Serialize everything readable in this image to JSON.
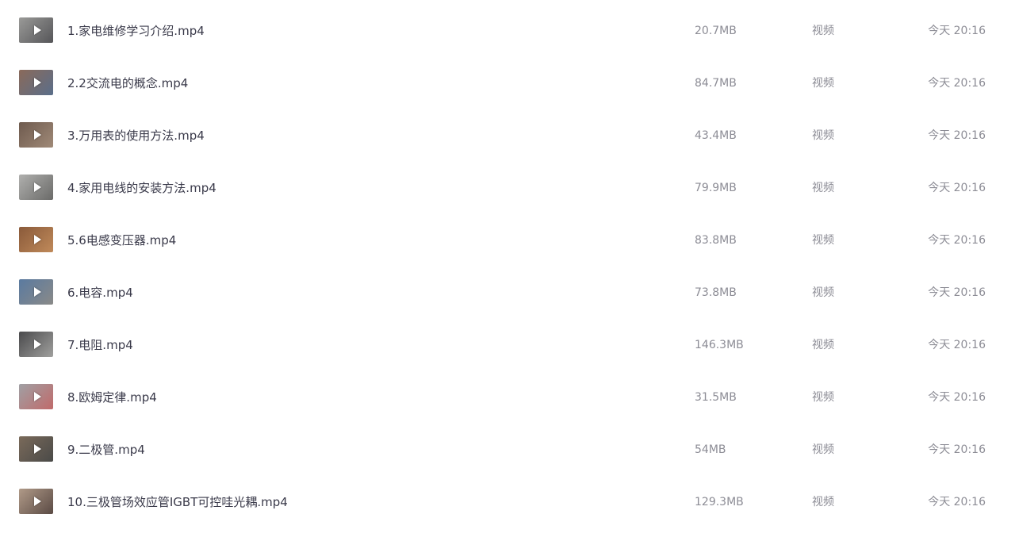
{
  "files": [
    {
      "name": "1.家电维修学习介绍.mp4",
      "size": "20.7MB",
      "type": "视频",
      "date": "今天 20:16",
      "thumb_icon": "video-thumbnail",
      "thumb_colors": [
        "#9a9a98",
        "#555558"
      ]
    },
    {
      "name": "2.2交流电的概念.mp4",
      "size": "84.7MB",
      "type": "视频",
      "date": "今天 20:16",
      "thumb_icon": "video-thumbnail",
      "thumb_colors": [
        "#8a6a5a",
        "#5a6e8a"
      ]
    },
    {
      "name": "3.万用表的使用方法.mp4",
      "size": "43.4MB",
      "type": "视频",
      "date": "今天 20:16",
      "thumb_icon": "video-thumbnail",
      "thumb_colors": [
        "#6e5a4e",
        "#a08a78"
      ]
    },
    {
      "name": "4.家用电线的安装方法.mp4",
      "size": "79.9MB",
      "type": "视频",
      "date": "今天 20:16",
      "thumb_icon": "video-thumbnail",
      "thumb_colors": [
        "#b0b0ae",
        "#6a6a68"
      ]
    },
    {
      "name": "5.6电感变压器.mp4",
      "size": "83.8MB",
      "type": "视频",
      "date": "今天 20:16",
      "thumb_icon": "video-thumbnail",
      "thumb_colors": [
        "#8a5a3a",
        "#c08a5a"
      ]
    },
    {
      "name": "6.电容.mp4",
      "size": "73.8MB",
      "type": "视频",
      "date": "今天 20:16",
      "thumb_icon": "video-thumbnail",
      "thumb_colors": [
        "#5a7aa0",
        "#8a8a88"
      ]
    },
    {
      "name": "7.电阻.mp4",
      "size": "146.3MB",
      "type": "视频",
      "date": "今天 20:16",
      "thumb_icon": "video-thumbnail",
      "thumb_colors": [
        "#4a4a4c",
        "#a0a09e"
      ]
    },
    {
      "name": "8.欧姆定律.mp4",
      "size": "31.5MB",
      "type": "视频",
      "date": "今天 20:16",
      "thumb_icon": "video-thumbnail",
      "thumb_colors": [
        "#a0a0a4",
        "#c06a6a"
      ]
    },
    {
      "name": "9.二极管.mp4",
      "size": "54MB",
      "type": "视频",
      "date": "今天 20:16",
      "thumb_icon": "video-thumbnail",
      "thumb_colors": [
        "#7a6a5a",
        "#4a4a48"
      ]
    },
    {
      "name": "10.三极管场效应管IGBT可控哇光耦.mp4",
      "size": "129.3MB",
      "type": "视频",
      "date": "今天 20:16",
      "thumb_icon": "video-thumbnail",
      "thumb_colors": [
        "#b09a88",
        "#5a4a44"
      ]
    }
  ]
}
